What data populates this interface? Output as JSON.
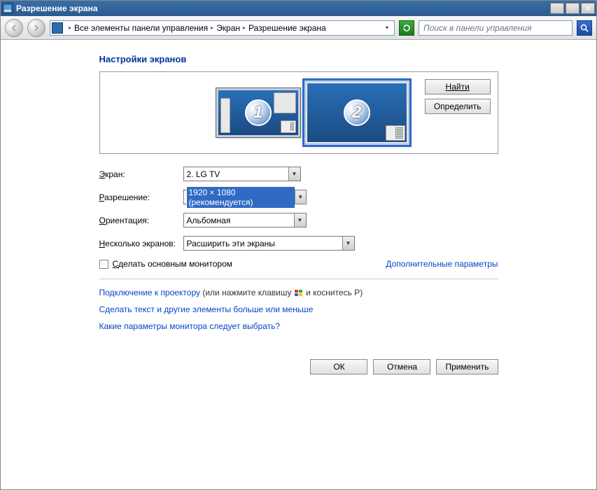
{
  "window": {
    "title": "Разрешение экрана"
  },
  "nav": {
    "crumb1": "Все элементы панели управления",
    "crumb2": "Экран",
    "crumb3": "Разрешение экрана",
    "search_placeholder": "Поиск в панели управления"
  },
  "main": {
    "heading": "Настройки экранов",
    "monitor1_num": "1",
    "monitor2_num": "2",
    "find_btn": "Найти",
    "identify_btn": "Определить",
    "screen_label_pre": "",
    "screen_label_u": "Э",
    "screen_label_post": "кран:",
    "screen_value": "2. LG TV",
    "res_label_pre": "",
    "res_label_u": "Р",
    "res_label_post": "азрешение:",
    "res_value": "1920 × 1080 (рекомендуется)",
    "orient_label_pre": "",
    "orient_label_u": "О",
    "orient_label_post": "риентация:",
    "orient_value": "Альбомная",
    "multi_label_pre": "",
    "multi_label_u": "Н",
    "multi_label_post": "есколько экранов:",
    "multi_value": "Расширить эти экраны",
    "primary_chk_pre": "",
    "primary_chk_u": "С",
    "primary_chk_post": "делать основным монитором",
    "advanced_link": "Дополнительные параметры",
    "proj_link": "Подключение к проектору",
    "proj_text1": " (или нажмите клавишу ",
    "proj_text2": " и коснитесь P)",
    "text_link": "Сделать текст и другие элементы больше или меньше",
    "which_link": "Какие параметры монитора следует выбрать?",
    "ok_btn": "ОК",
    "cancel_btn": "Отмена",
    "apply_btn": "Применить"
  }
}
